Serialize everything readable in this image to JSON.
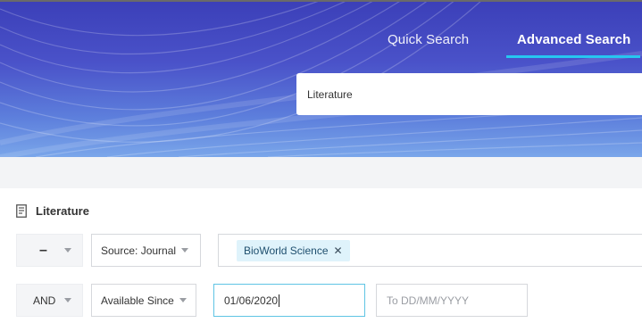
{
  "tabs": {
    "quick_search": "Quick Search",
    "advanced_search": "Advanced Search"
  },
  "search": {
    "value": "Literature"
  },
  "section": {
    "title": "Literature"
  },
  "row1": {
    "operator": "–",
    "field_select": "Source: Journal",
    "chips": [
      {
        "label": "BioWorld Science",
        "remove_glyph": "✕"
      }
    ]
  },
  "row2": {
    "operator": "AND",
    "field_select": "Available Since",
    "date_from": "01/06/2020",
    "date_to_placeholder": "To DD/MM/YYYY"
  },
  "colors": {
    "accent": "#26c6f0",
    "banner": "#4a52c9"
  }
}
